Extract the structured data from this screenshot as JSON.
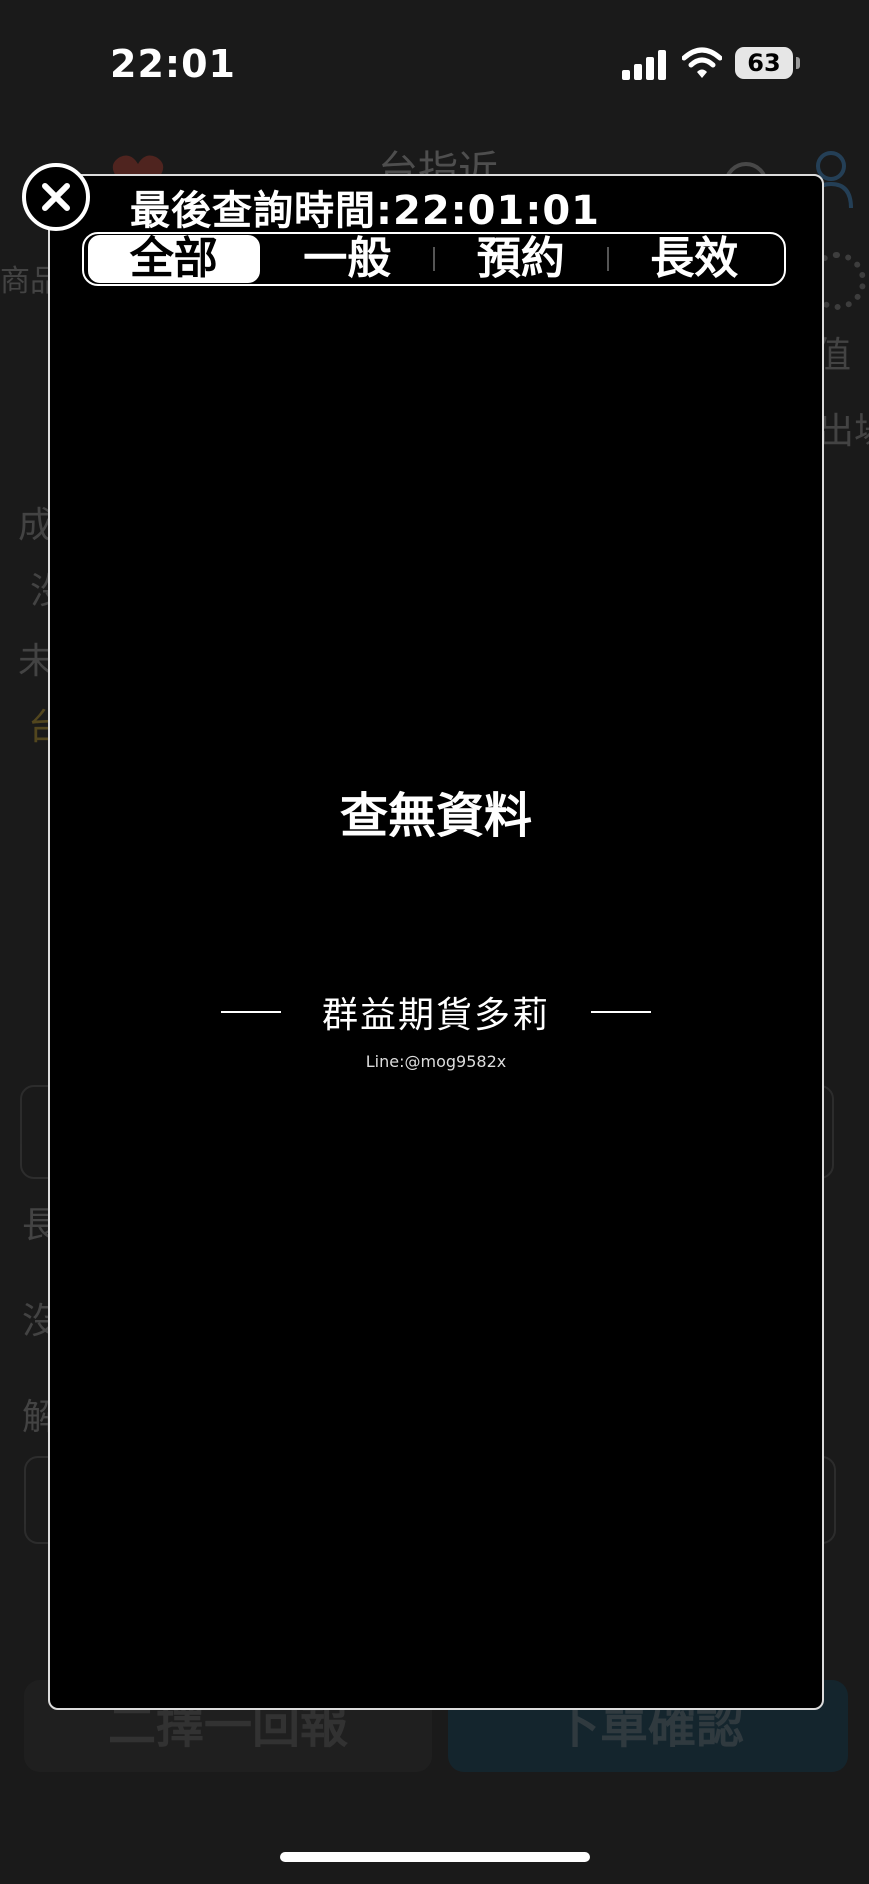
{
  "status_bar": {
    "time": "22:01",
    "battery_level": "63"
  },
  "background": {
    "title": "台指近",
    "product_label": "商品",
    "row_labels": [
      "成",
      "沒",
      "未",
      "台"
    ],
    "right_labels": [
      "值",
      "出場"
    ],
    "field_labels": [
      "長",
      "沒",
      "解"
    ],
    "button_left": "二擇一回報",
    "button_right": "下單確認"
  },
  "modal": {
    "query_time_label": "最後查詢時間:22:01:01",
    "tabs": [
      {
        "label": "全部",
        "active": true
      },
      {
        "label": "一般",
        "active": false
      },
      {
        "label": "預約",
        "active": false
      },
      {
        "label": "長效",
        "active": false
      }
    ],
    "empty_message": "查無資料",
    "watermark_name": "群益期貨多莉",
    "watermark_line_id": "Line:@mog9582x"
  },
  "icons": {
    "close": "close-icon",
    "signal": "cellular-signal-icon",
    "wifi": "wifi-icon",
    "battery": "battery-icon",
    "heart": "heart-icon",
    "search": "search-icon",
    "user": "user-icon",
    "gear": "gear-icon"
  },
  "colors": {
    "modal_background": "#000000",
    "active_tab_background": "#ffffff",
    "active_tab_text": "#000000",
    "confirm_button": "#0a3d57"
  }
}
